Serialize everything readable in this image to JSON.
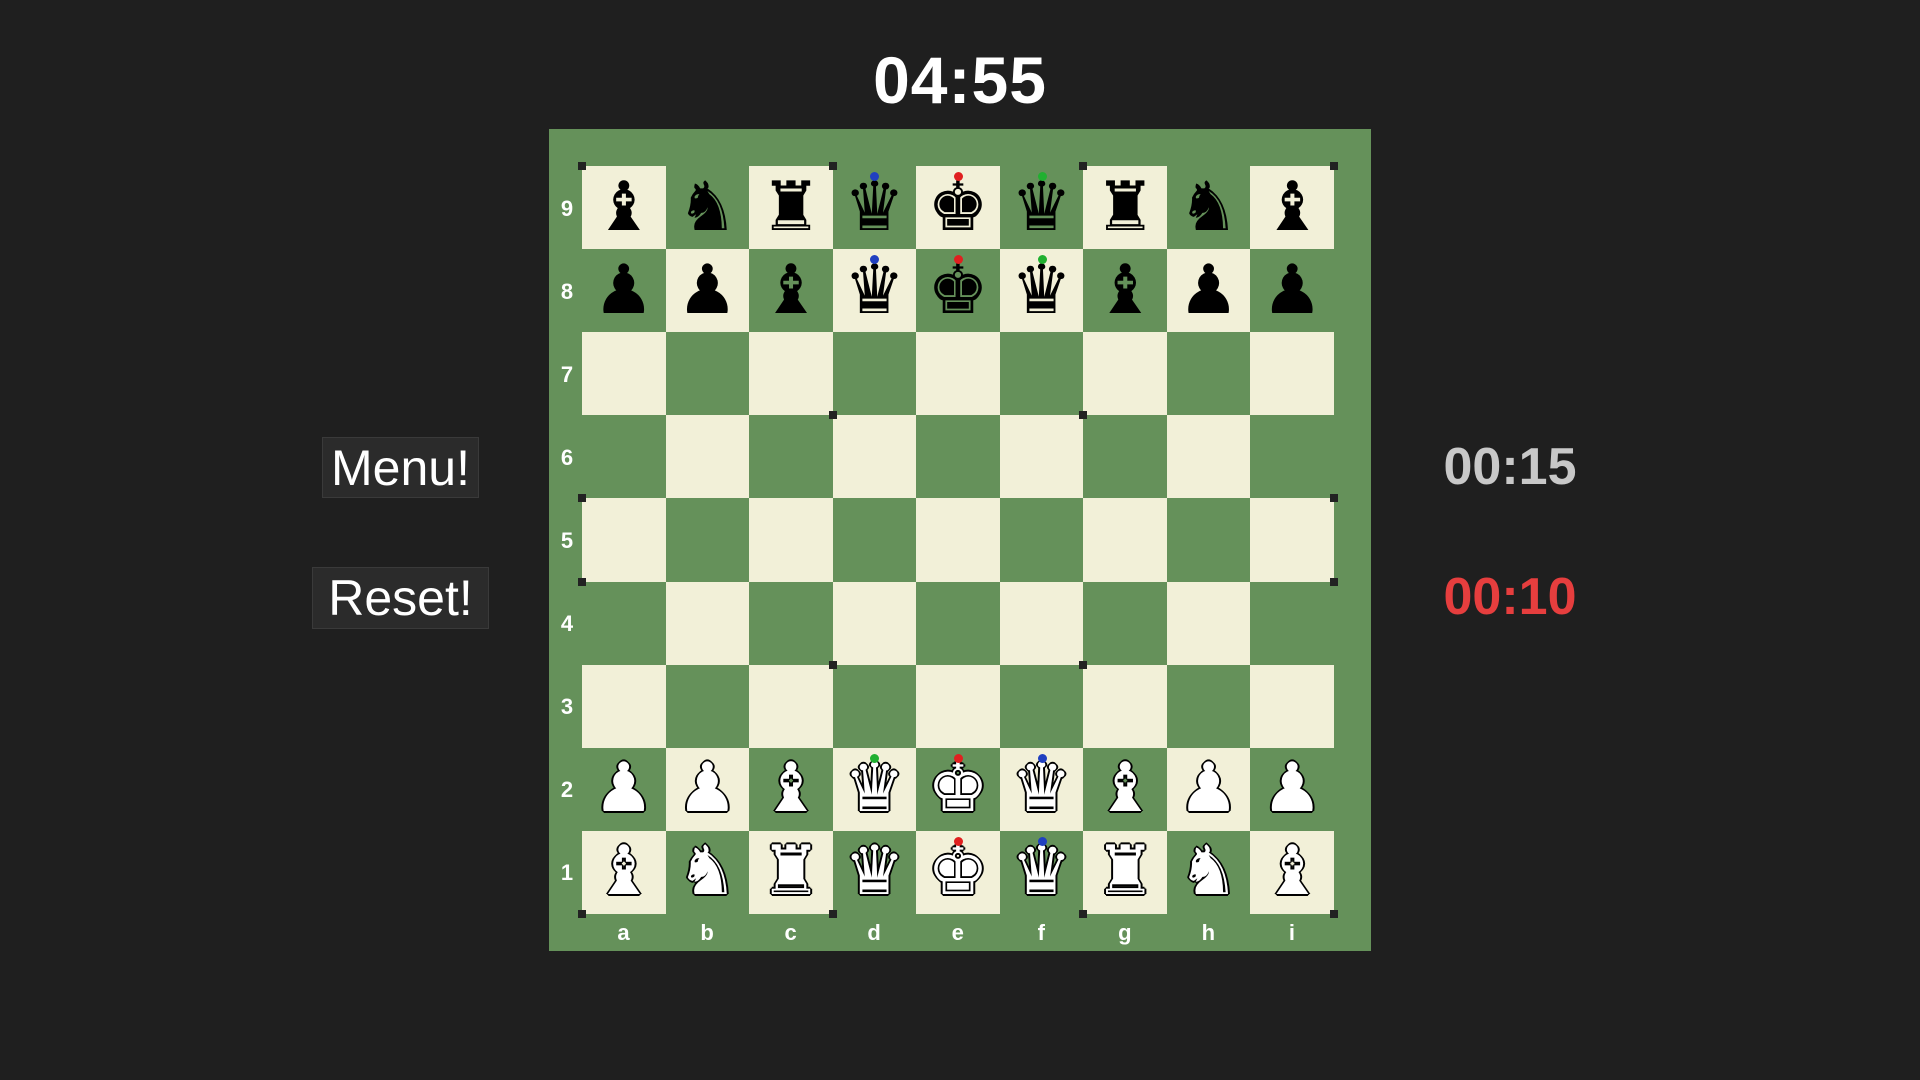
{
  "timers": {
    "main": "04:55",
    "top": "00:15",
    "bottom": "00:10"
  },
  "buttons": {
    "menu": "Menu!",
    "reset": "Reset!"
  },
  "colors": {
    "background": "#1f1f1f",
    "board_border": "#65915a",
    "square_light": "#f2f0d8",
    "square_dark": "#65915a",
    "timer_main": "#ffffff",
    "timer_top": "#c8c8c8",
    "timer_bottom": "#e63e3e",
    "button_bg": "#2b2b2b",
    "gem_red": "#e02020",
    "gem_blue": "#2040c0",
    "gem_green": "#20b030"
  },
  "board": {
    "files": [
      "a",
      "b",
      "c",
      "d",
      "e",
      "f",
      "g",
      "h",
      "i"
    ],
    "ranks": [
      "9",
      "8",
      "7",
      "6",
      "5",
      "4",
      "3",
      "2",
      "1"
    ],
    "pieces": {
      "a9": {
        "color": "black",
        "type": "archbishop",
        "icon": "archbishop-icon"
      },
      "b9": {
        "color": "black",
        "type": "knight",
        "icon": "knight-icon"
      },
      "c9": {
        "color": "black",
        "type": "rook",
        "icon": "rook-icon"
      },
      "d9": {
        "color": "black",
        "type": "queen",
        "icon": "queen-icon",
        "gem": "blue"
      },
      "e9": {
        "color": "black",
        "type": "king",
        "icon": "king-icon",
        "gem": "red"
      },
      "f9": {
        "color": "black",
        "type": "queen",
        "icon": "queen-icon",
        "gem": "green"
      },
      "g9": {
        "color": "black",
        "type": "rook",
        "icon": "rook-icon"
      },
      "h9": {
        "color": "black",
        "type": "knight",
        "icon": "knight-icon"
      },
      "i9": {
        "color": "black",
        "type": "archbishop",
        "icon": "archbishop-icon"
      },
      "a8": {
        "color": "black",
        "type": "pawn",
        "icon": "pawn-icon"
      },
      "b8": {
        "color": "black",
        "type": "sergeant",
        "icon": "sergeant-icon"
      },
      "c8": {
        "color": "black",
        "type": "bishop",
        "icon": "bishop-icon"
      },
      "d8": {
        "color": "black",
        "type": "prince",
        "icon": "prince-icon",
        "gem": "blue"
      },
      "e8": {
        "color": "black",
        "type": "heir",
        "icon": "heir-icon",
        "gem": "red"
      },
      "f8": {
        "color": "black",
        "type": "prince",
        "icon": "prince-icon",
        "gem": "green"
      },
      "g8": {
        "color": "black",
        "type": "bishop",
        "icon": "bishop-icon"
      },
      "h8": {
        "color": "black",
        "type": "sergeant",
        "icon": "sergeant-icon"
      },
      "i8": {
        "color": "black",
        "type": "pawn",
        "icon": "pawn-icon"
      },
      "a2": {
        "color": "white",
        "type": "pawn",
        "icon": "pawn-icon"
      },
      "b2": {
        "color": "white",
        "type": "sergeant",
        "icon": "sergeant-icon"
      },
      "c2": {
        "color": "white",
        "type": "bishop",
        "icon": "bishop-icon"
      },
      "d2": {
        "color": "white",
        "type": "prince",
        "icon": "prince-icon",
        "gem": "green"
      },
      "e2": {
        "color": "white",
        "type": "heir",
        "icon": "heir-icon",
        "gem": "red"
      },
      "f2": {
        "color": "white",
        "type": "prince",
        "icon": "prince-icon",
        "gem": "blue"
      },
      "g2": {
        "color": "white",
        "type": "bishop",
        "icon": "bishop-icon"
      },
      "h2": {
        "color": "white",
        "type": "sergeant",
        "icon": "sergeant-icon"
      },
      "i2": {
        "color": "white",
        "type": "pawn",
        "icon": "pawn-icon"
      },
      "a1": {
        "color": "white",
        "type": "archbishop",
        "icon": "archbishop-icon"
      },
      "b1": {
        "color": "white",
        "type": "knight",
        "icon": "knight-icon"
      },
      "c1": {
        "color": "white",
        "type": "rook",
        "icon": "rook-icon"
      },
      "d1": {
        "color": "white",
        "type": "queen",
        "icon": "queen-icon"
      },
      "e1": {
        "color": "white",
        "type": "king",
        "icon": "king-icon",
        "gem": "red"
      },
      "f1": {
        "color": "white",
        "type": "queen",
        "icon": "queen-icon",
        "gem": "blue"
      },
      "g1": {
        "color": "white",
        "type": "rook",
        "icon": "rook-icon"
      },
      "h1": {
        "color": "white",
        "type": "knight",
        "icon": "knight-icon"
      },
      "i1": {
        "color": "white",
        "type": "archbishop",
        "icon": "archbishop-icon"
      }
    }
  }
}
